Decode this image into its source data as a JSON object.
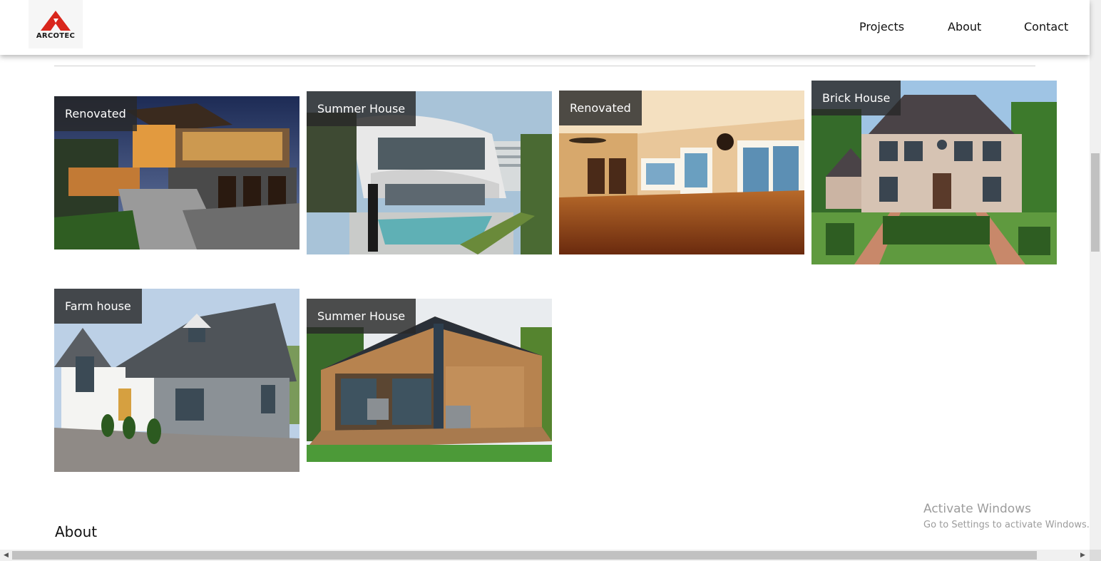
{
  "brand": {
    "name": "ARCOTEC",
    "color": "#d9261c"
  },
  "nav": {
    "projects": "Projects",
    "about": "About",
    "contact": "Contact"
  },
  "gallery": [
    {
      "label": "Renovated"
    },
    {
      "label": "Summer House"
    },
    {
      "label": "Renovated"
    },
    {
      "label": "Brick House"
    },
    {
      "label": "Farm house"
    },
    {
      "label": "Summer House"
    }
  ],
  "sections": {
    "about_heading": "About"
  },
  "watermark": {
    "title": "Activate Windows",
    "subtitle": "Go to Settings to activate Windows."
  }
}
